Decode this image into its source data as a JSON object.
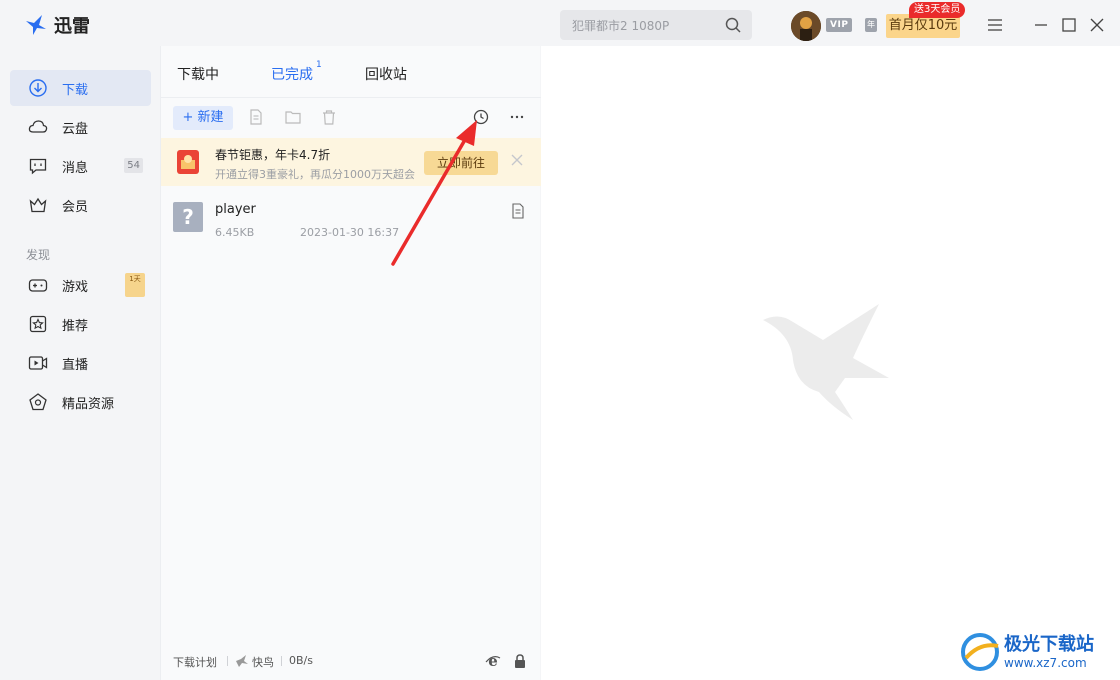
{
  "app": {
    "name": "迅雷",
    "brand_color": "#2a6ef0"
  },
  "search": {
    "placeholder": "犯罪都市2 1080P"
  },
  "user": {
    "vip_label": "VIP",
    "year_label": "年",
    "promo_button": "首月仅10元",
    "promo_tag": "送3天会员"
  },
  "sidebar": {
    "items": [
      {
        "label": "下载",
        "icon": "download-icon",
        "active": true
      },
      {
        "label": "云盘",
        "icon": "cloud-icon"
      },
      {
        "label": "消息",
        "icon": "message-icon",
        "badge": "54"
      },
      {
        "label": "会员",
        "icon": "crown-icon"
      }
    ],
    "discover_title": "发现",
    "discover_items": [
      {
        "label": "游戏",
        "icon": "gamepad-icon",
        "tag": "1天"
      },
      {
        "label": "推荐",
        "icon": "star-icon"
      },
      {
        "label": "直播",
        "icon": "live-icon"
      },
      {
        "label": "精品资源",
        "icon": "gem-icon"
      }
    ]
  },
  "tabs": [
    {
      "label": "下载中"
    },
    {
      "label": "已完成",
      "count": "1",
      "active": true
    },
    {
      "label": "回收站"
    }
  ],
  "toolbar": {
    "new_label": "+ 新建"
  },
  "banner": {
    "title": "春节钜惠，年卡4.7折",
    "subtitle": "开通立得3重豪礼，再瓜分1000万天超会",
    "button": "立即前往"
  },
  "files": [
    {
      "name": "player",
      "size": "6.45KB",
      "date": "2023-01-30 16:37",
      "icon": "unknown-file-icon"
    }
  ],
  "status": {
    "plan": "下载计划",
    "mode": "快鸟",
    "speed": "0B/s"
  },
  "watermark": {
    "title": "极光下载站",
    "url": "www.xz7.com"
  },
  "colors": {
    "accent": "#2a6ef0",
    "annotation": "#ea2b2b",
    "promo": "#fbd58b"
  }
}
